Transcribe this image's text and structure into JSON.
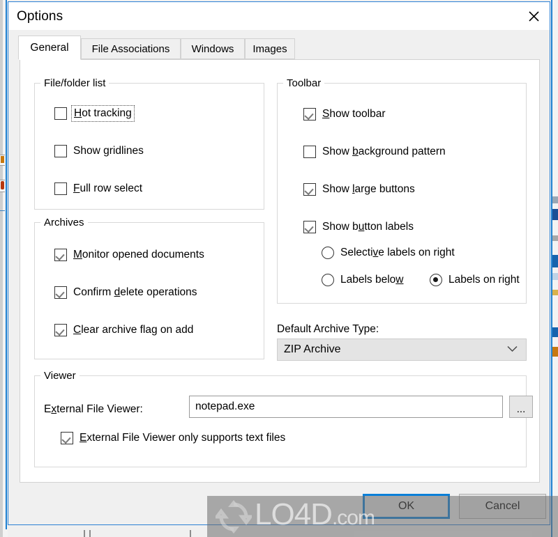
{
  "window": {
    "title": "Options",
    "close_icon": "close-x-icon",
    "accent_focus": "#0a7fd8",
    "border_color": "#2a7fd4"
  },
  "tabs": [
    {
      "label": "General",
      "active": true
    },
    {
      "label": "File Associations",
      "active": false
    },
    {
      "label": "Windows",
      "active": false
    },
    {
      "label": "Images",
      "active": false
    }
  ],
  "groups": {
    "file_folder_list": {
      "legend": "File/folder list",
      "items": [
        {
          "label": "Hot tracking",
          "accel": "H",
          "checked": false,
          "focused": true
        },
        {
          "label": "Show gridlines",
          "accel": "g",
          "checked": false,
          "focused": false
        },
        {
          "label": "Full row select",
          "accel": "F",
          "checked": false,
          "focused": false
        }
      ]
    },
    "archives": {
      "legend": "Archives",
      "items": [
        {
          "label": "Monitor opened documents",
          "accel": "M",
          "checked": true
        },
        {
          "label": "Confirm delete operations",
          "accel": "d",
          "checked": true
        },
        {
          "label": "Clear archive flag on add",
          "accel": "C",
          "checked": true
        }
      ]
    },
    "toolbar": {
      "legend": "Toolbar",
      "items": [
        {
          "label": "Show toolbar",
          "accel": "S",
          "checked": true
        },
        {
          "label": "Show background pattern",
          "accel": "b",
          "checked": false
        },
        {
          "label": "Show large buttons",
          "accel": "l",
          "checked": true
        },
        {
          "label": "Show button labels",
          "accel": "u",
          "checked": true
        }
      ],
      "radios": [
        {
          "label": "Selective labels on right",
          "accel": "v",
          "selected": false
        },
        {
          "label": "Labels below",
          "accel": "w",
          "selected": false
        },
        {
          "label": "Labels on right",
          "accel": "g",
          "selected": true
        }
      ]
    },
    "viewer": {
      "legend": "Viewer",
      "field_label": "External File Viewer:",
      "field_label_accel": "x",
      "field_value": "notepad.exe",
      "field_placeholder": "",
      "browse_label": "...",
      "checkbox": {
        "label": "External File Viewer only supports text files",
        "accel": "E",
        "checked": true
      }
    }
  },
  "archive_type": {
    "label": "Default Archive Type:",
    "selected": "ZIP Archive",
    "options": [
      "ZIP Archive"
    ],
    "chevron_icon": "chevron-down-icon"
  },
  "footer": {
    "ok_label": "OK",
    "cancel_label": "Cancel"
  },
  "watermark": {
    "text": "LO4D",
    "suffix": ".com",
    "logo_icon": "refresh-circular-arrows-icon"
  }
}
